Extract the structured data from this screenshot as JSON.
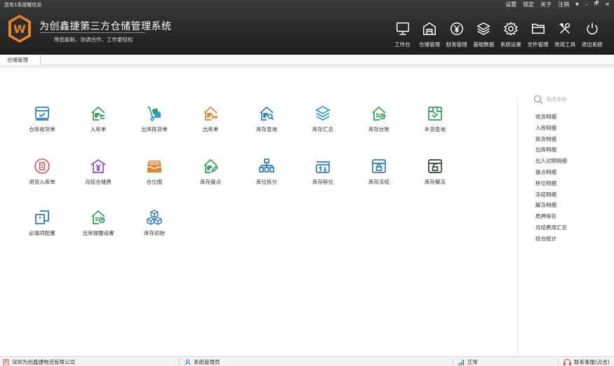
{
  "header": {
    "notice": "您有1条提醒信息",
    "top_links": [
      "设置",
      "锁定",
      "关于",
      "注销"
    ],
    "window_controls": [
      "▼",
      "–",
      "🗗",
      "✕"
    ],
    "title": "为创鑫捷第三方仓储管理系统",
    "subtitle": "降低能耗、协调合作、工作更轻松",
    "logo_letter": "W",
    "logo_color": "#e8822a"
  },
  "toolbar": [
    {
      "label": "工作台",
      "icon": "monitor-icon"
    },
    {
      "label": "仓储管理",
      "icon": "warehouse-icon"
    },
    {
      "label": "财务管理",
      "icon": "yen-icon"
    },
    {
      "label": "基础数据",
      "icon": "layers-icon"
    },
    {
      "label": "系统设置",
      "icon": "gear-icon"
    },
    {
      "label": "文件管理",
      "icon": "folder-icon"
    },
    {
      "label": "常用工具",
      "icon": "tools-icon"
    },
    {
      "label": "退出系统",
      "icon": "power-icon"
    }
  ],
  "tabs": [
    {
      "label": "仓储管理"
    }
  ],
  "modules": [
    {
      "label": "仓库收货单",
      "icon": "receipt-icon",
      "color": "#2f7cc6"
    },
    {
      "label": "入库单",
      "icon": "inbound-house-icon",
      "color": "#2fa05a"
    },
    {
      "label": "出库拣货单",
      "icon": "hand-truck-icon",
      "color": "#2f9bd6"
    },
    {
      "label": "出库单",
      "icon": "outbound-house-icon",
      "color": "#e8822a"
    },
    {
      "label": "库存查询",
      "icon": "stock-search-icon",
      "color": "#2f7cc6"
    },
    {
      "label": "库存汇总",
      "icon": "stack-icon",
      "color": "#2f9bd6"
    },
    {
      "label": "库存台账",
      "icon": "ledger-house-icon",
      "color": "#2fa05a"
    },
    {
      "label": "补货查询",
      "icon": "replenish-icon",
      "color": "#2fa05a"
    },
    {
      "label": "退货入库单",
      "icon": "return-icon",
      "color": "#e05050"
    },
    {
      "label": "月结仓储费",
      "icon": "monthly-fee-icon",
      "color": "#8e4fc0"
    },
    {
      "label": "仓位图",
      "icon": "tray-icon",
      "color": "#e8822a"
    },
    {
      "label": "库存盘点",
      "icon": "stocktake-icon",
      "color": "#2fa05a"
    },
    {
      "label": "库位拆分",
      "icon": "hierarchy-icon",
      "color": "#2f7cc6"
    },
    {
      "label": "库存移位",
      "icon": "transfer-icon",
      "color": "#2f7cc6"
    },
    {
      "label": "库存冻结",
      "icon": "lock-box-icon",
      "color": "#2f7cc6"
    },
    {
      "label": "库存解冻",
      "icon": "unlock-box-icon",
      "color": "#2a4a2a"
    },
    {
      "label": "必填项配置",
      "icon": "config-icon",
      "color": "#2f7cc6"
    },
    {
      "label": "出库提醒设置",
      "icon": "reminder-house-icon",
      "color": "#2fa05a"
    },
    {
      "label": "库存初始",
      "icon": "cubes-icon",
      "color": "#2f7cc6"
    }
  ],
  "search": {
    "placeholder": "相关查询"
  },
  "quick_links": [
    "收货明细",
    "入库明细",
    "拣货明细",
    "出库明细",
    "出入对照明细",
    "盘点明细",
    "移位明细",
    "冻结明细",
    "解冻明细",
    "质押库存",
    "月结费用汇总",
    "综合统计"
  ],
  "status": {
    "company": "深圳为创鑫捷物流有限公司",
    "user": "系统管理员",
    "signal": "正常",
    "support": "联系客服(点击)"
  }
}
